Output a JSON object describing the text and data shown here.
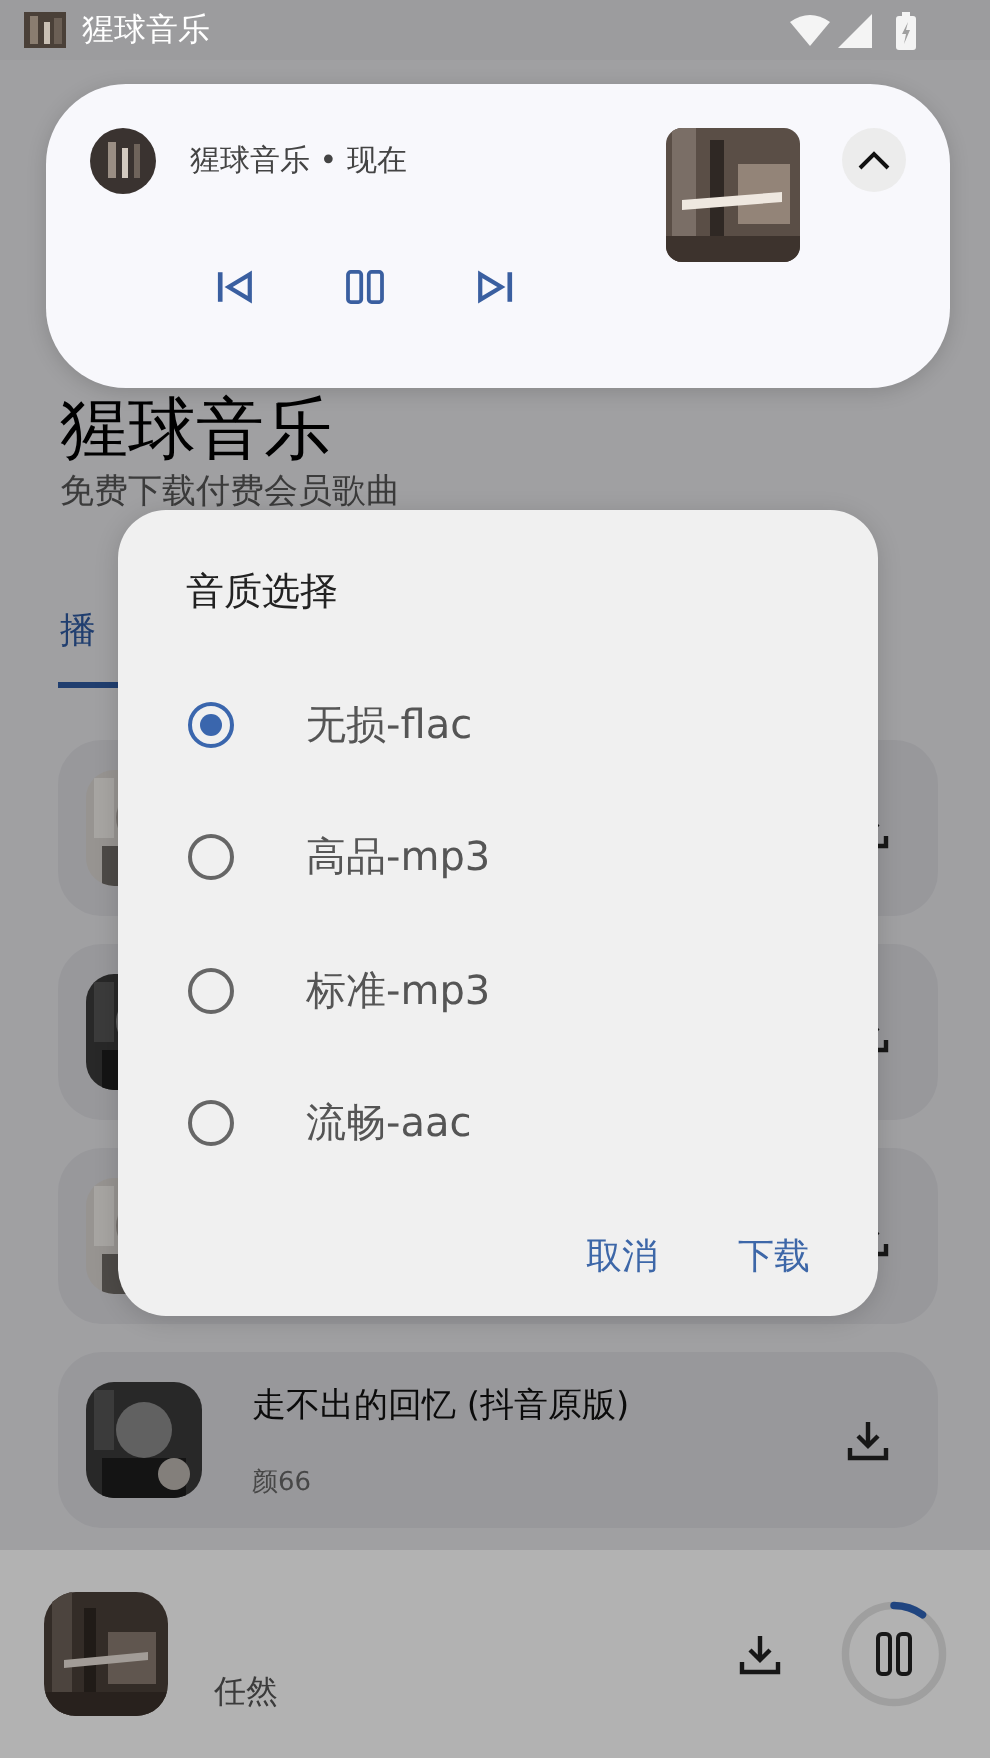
{
  "status_bar": {
    "app_name": "猩球音乐"
  },
  "notification": {
    "app_line": "猩球音乐 • 现在"
  },
  "header": {
    "title": "猩球音乐",
    "subtitle": "免费下载付费会员歌曲"
  },
  "tabs": [
    {
      "label": "播",
      "selected": true
    }
  ],
  "songs": [
    {
      "kind": "covered"
    },
    {
      "kind": "covered"
    },
    {
      "kind": "covered"
    },
    {
      "kind": "full",
      "title": "走不出的回忆 (抖音原版)",
      "artist": "颜66"
    }
  ],
  "player": {
    "artist": "任然",
    "level": 0.1
  },
  "dialog": {
    "title": "音质选择",
    "options": [
      {
        "label": "无损-flac",
        "selected": true
      },
      {
        "label": "高品-mp3",
        "selected": false
      },
      {
        "label": "标准-mp3",
        "selected": false
      },
      {
        "label": "流畅-aac",
        "selected": false
      }
    ],
    "buttons": [
      "取消",
      "下载"
    ]
  }
}
